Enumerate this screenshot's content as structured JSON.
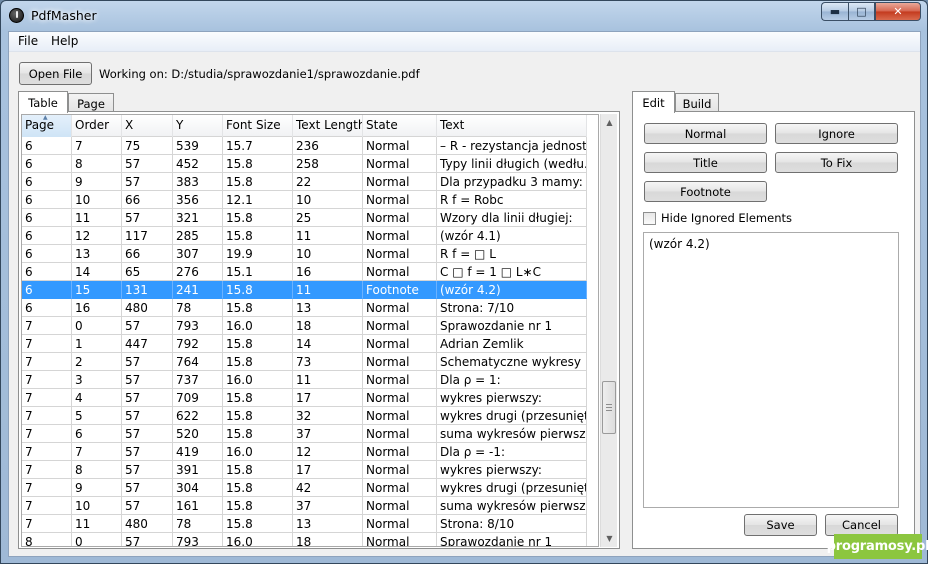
{
  "window": {
    "title": "PdfMasher",
    "min_glyph": "▬",
    "max_glyph": "□",
    "close_glyph": "✕"
  },
  "menu": [
    {
      "label": "File"
    },
    {
      "label": "Help"
    }
  ],
  "toolbar": {
    "open_file_label": "Open File",
    "working_on": "Working on: D:/studia/sprawozdanie1/sprawozdanie.pdf"
  },
  "left_tabs": [
    {
      "label": "Table",
      "active": true
    },
    {
      "label": "Page",
      "active": false
    }
  ],
  "table": {
    "columns": [
      "Page",
      "Order",
      "X",
      "Y",
      "Font Size",
      "Text Length",
      "State",
      "Text"
    ],
    "sorted_column": "Page",
    "selected_row_index": 8,
    "rows": [
      [
        "6",
        "7",
        "75",
        "539",
        "15.7",
        "236",
        "Normal",
        "– R - rezystancja jednostk..."
      ],
      [
        "6",
        "8",
        "57",
        "452",
        "15.8",
        "258",
        "Normal",
        "Typy linii długich (wedłu..."
      ],
      [
        "6",
        "9",
        "57",
        "383",
        "15.8",
        "22",
        "Normal",
        "Dla przypadku 3 mamy:"
      ],
      [
        "6",
        "10",
        "66",
        "356",
        "12.1",
        "10",
        "Normal",
        "R f = Robc"
      ],
      [
        "6",
        "11",
        "57",
        "321",
        "15.8",
        "25",
        "Normal",
        "Wzory dla linii długiej:"
      ],
      [
        "6",
        "12",
        "117",
        "285",
        "15.8",
        "11",
        "Normal",
        "(wzór 4.1)"
      ],
      [
        "6",
        "13",
        "66",
        "307",
        "19.9",
        "10",
        "Normal",
        "R f = □ L"
      ],
      [
        "6",
        "14",
        "65",
        "276",
        "15.1",
        "16",
        "Normal",
        "C □ f = 1 □ L∗C"
      ],
      [
        "6",
        "15",
        "131",
        "241",
        "15.8",
        "11",
        "Footnote",
        "(wzór 4.2)"
      ],
      [
        "6",
        "16",
        "480",
        "78",
        "15.8",
        "13",
        "Normal",
        "Strona: 7/10"
      ],
      [
        "7",
        "0",
        "57",
        "793",
        "16.0",
        "18",
        "Normal",
        "Sprawozdanie nr 1"
      ],
      [
        "7",
        "1",
        "447",
        "792",
        "15.8",
        "14",
        "Normal",
        "Adrian Zemlik"
      ],
      [
        "7",
        "2",
        "57",
        "764",
        "15.8",
        "73",
        "Normal",
        "Schematyczne wykresy i..."
      ],
      [
        "7",
        "3",
        "57",
        "737",
        "16.0",
        "11",
        "Normal",
        "Dla ρ = 1:"
      ],
      [
        "7",
        "4",
        "57",
        "709",
        "15.8",
        "17",
        "Normal",
        "wykres pierwszy:"
      ],
      [
        "7",
        "5",
        "57",
        "622",
        "15.8",
        "32",
        "Normal",
        "wykres drugi (przesunięt..."
      ],
      [
        "7",
        "6",
        "57",
        "520",
        "15.8",
        "37",
        "Normal",
        "suma wykresów pierwsze..."
      ],
      [
        "7",
        "7",
        "57",
        "419",
        "16.0",
        "12",
        "Normal",
        "Dla ρ = -1:"
      ],
      [
        "7",
        "8",
        "57",
        "391",
        "15.8",
        "17",
        "Normal",
        "wykres pierwszy:"
      ],
      [
        "7",
        "9",
        "57",
        "304",
        "15.8",
        "42",
        "Normal",
        "wykres drugi (przesunięt..."
      ],
      [
        "7",
        "10",
        "57",
        "161",
        "15.8",
        "37",
        "Normal",
        "suma wykresów pierwsze..."
      ],
      [
        "7",
        "11",
        "480",
        "78",
        "15.8",
        "13",
        "Normal",
        "Strona: 8/10"
      ],
      [
        "8",
        "0",
        "57",
        "793",
        "16.0",
        "18",
        "Normal",
        "Sprawozdanie nr 1"
      ]
    ]
  },
  "right_tabs": [
    {
      "label": "Edit",
      "active": true
    },
    {
      "label": "Build",
      "active": false
    }
  ],
  "edit": {
    "normal_label": "Normal",
    "ignore_label": "Ignore",
    "title_label": "Title",
    "tofix_label": "To Fix",
    "footnote_label": "Footnote",
    "hide_ignored_label": "Hide Ignored Elements",
    "hide_ignored_checked": false,
    "text_value": "(wzór 4.2)",
    "save_label": "Save",
    "cancel_label": "Cancel"
  },
  "scroll_up_glyph": "▲",
  "scroll_down_glyph": "▼",
  "sort_glyph": "▲",
  "watermark": "programosy.pl"
}
